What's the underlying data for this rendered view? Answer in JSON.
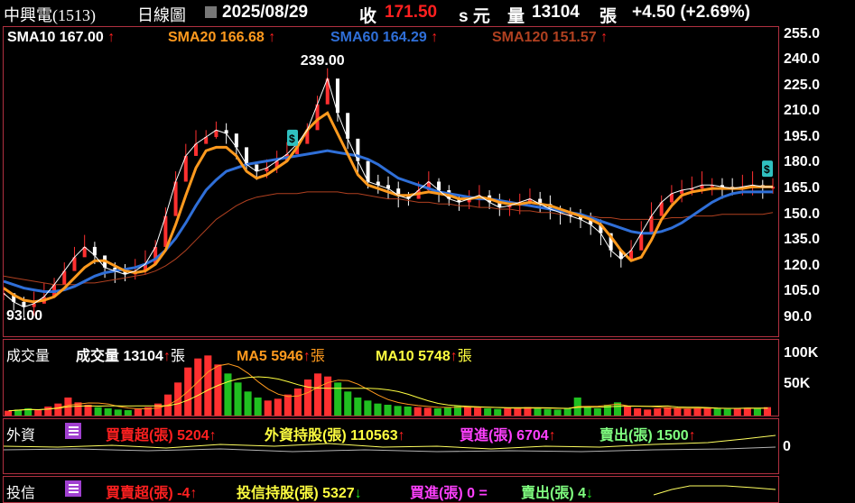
{
  "header": {
    "stock": "中興電(1513)",
    "chart_type": "日線圖",
    "date": "2025/08/29",
    "close_label": "收",
    "close_value": "171.50",
    "unit": "s 元",
    "volume_label": "量",
    "volume_value": "13104",
    "volume_unit": "張",
    "change": "+4.50 (+2.69%)"
  },
  "price_legend": {
    "sma10": "SMA10 167.00",
    "sma20": "SMA20 166.68",
    "sma60": "SMA60 164.29",
    "sma120": "SMA120 151.57"
  },
  "volume_legend": {
    "title": "成交量",
    "vol": "成交量 13104",
    "vol_unit": "張",
    "ma5": "MA5 5946",
    "ma5_unit": "張",
    "ma10": "MA10 5748",
    "ma10_unit": "張"
  },
  "foreign_legend": {
    "title": "外資",
    "net": "買賣超(張) 5204",
    "holding": "外資持股(張) 110563",
    "buy": "買進(張) 6704",
    "sell": "賣出(張) 1500"
  },
  "trust_legend": {
    "title": "投信",
    "net": "買賣超(張) -4",
    "holding": "投信持股(張) 5327",
    "buy": "買進(張) 0 =",
    "sell": "賣出(張) 4"
  },
  "foreign_axis_label": "0",
  "colors": {
    "up": "#ff2020",
    "down": "#20e020",
    "sma10": "#ffffff",
    "sma20": "#ff9a1e",
    "sma60": "#2f6fd8",
    "sma120": "#b04020",
    "border": "#b03040"
  },
  "chart_data": [
    {
      "type": "line",
      "name": "price",
      "annotations": {
        "high": "239.00",
        "low": "93.00"
      },
      "yticks": [
        "255.0",
        "240.0",
        "225.0",
        "210.0",
        "195.0",
        "180.0",
        "165.0",
        "150.0",
        "135.0",
        "120.0",
        "105.0",
        "90.0"
      ],
      "ylim": [
        80,
        260
      ],
      "series": [
        {
          "name": "SMA10",
          "values": [
            105,
            100,
            97,
            99,
            103,
            110,
            118,
            126,
            132,
            127,
            120,
            118,
            116,
            118,
            122,
            132,
            150,
            170,
            185,
            192,
            196,
            200,
            198,
            190,
            180,
            176,
            178,
            182,
            186,
            192,
            200,
            215,
            230,
            210,
            195,
            182,
            170,
            168,
            166,
            162,
            160,
            165,
            170,
            165,
            160,
            158,
            160,
            162,
            158,
            155,
            156,
            158,
            160,
            157,
            154,
            152,
            150,
            148,
            145,
            140,
            130,
            125,
            130,
            140,
            150,
            158,
            163,
            165,
            166,
            168,
            168,
            167,
            166,
            167,
            168,
            167,
            167
          ]
        },
        {
          "name": "SMA20",
          "values": [
            108,
            104,
            101,
            100,
            101,
            103,
            108,
            114,
            120,
            124,
            124,
            121,
            118,
            117,
            118,
            122,
            130,
            145,
            162,
            178,
            188,
            190,
            190,
            185,
            176,
            172,
            174,
            178,
            182,
            190,
            200,
            206,
            210,
            198,
            186,
            174,
            168,
            166,
            164,
            162,
            162,
            163,
            164,
            163,
            162,
            160,
            160,
            161,
            160,
            158,
            157,
            157,
            158,
            157,
            156,
            154,
            152,
            150,
            148,
            145,
            138,
            130,
            124,
            126,
            136,
            148,
            156,
            162,
            164,
            165,
            166,
            166,
            166,
            166,
            167,
            167,
            167
          ]
        },
        {
          "name": "SMA60",
          "values": [
            112,
            110,
            108,
            107,
            106,
            106,
            107,
            109,
            112,
            115,
            117,
            118,
            119,
            120,
            122,
            125,
            130,
            137,
            146,
            156,
            165,
            171,
            176,
            178,
            180,
            181,
            182,
            183,
            184,
            185,
            186,
            187,
            188,
            187,
            186,
            185,
            183,
            180,
            176,
            172,
            170,
            168,
            166,
            164,
            163,
            162,
            161,
            160,
            160,
            159,
            158,
            157,
            156,
            155,
            154,
            153,
            152,
            151,
            149,
            147,
            145,
            143,
            141,
            140,
            140,
            141,
            143,
            146,
            150,
            154,
            158,
            161,
            163,
            164,
            164,
            164,
            164
          ]
        },
        {
          "name": "SMA120",
          "values": [
            115,
            114,
            113,
            112,
            111,
            110,
            110,
            110,
            111,
            111,
            112,
            113,
            114,
            115,
            116,
            118,
            121,
            125,
            130,
            136,
            142,
            148,
            152,
            156,
            159,
            161,
            162,
            163,
            163,
            163,
            164,
            164,
            164,
            164,
            163,
            163,
            162,
            161,
            160,
            160,
            159,
            158,
            158,
            157,
            157,
            156,
            156,
            155,
            155,
            154,
            154,
            153,
            153,
            152,
            152,
            151,
            151,
            150,
            150,
            149,
            149,
            148,
            148,
            148,
            148,
            148,
            149,
            149,
            150,
            150,
            150,
            151,
            151,
            151,
            151,
            151,
            152
          ]
        }
      ]
    },
    {
      "type": "bar",
      "name": "volume",
      "yticks": [
        "100K",
        "50K"
      ],
      "ylim": [
        0,
        120
      ],
      "values": [
        8,
        10,
        12,
        9,
        15,
        20,
        30,
        22,
        18,
        14,
        12,
        10,
        9,
        11,
        14,
        20,
        35,
        55,
        80,
        95,
        100,
        85,
        70,
        55,
        40,
        30,
        25,
        28,
        35,
        45,
        60,
        70,
        65,
        55,
        40,
        30,
        25,
        20,
        18,
        16,
        15,
        14,
        13,
        12,
        14,
        16,
        15,
        13,
        12,
        11,
        12,
        13,
        14,
        12,
        11,
        10,
        12,
        30,
        14,
        12,
        18,
        22,
        15,
        12,
        10,
        12,
        14,
        13,
        11,
        12,
        13,
        12,
        11,
        12,
        13,
        12,
        14
      ]
    }
  ]
}
